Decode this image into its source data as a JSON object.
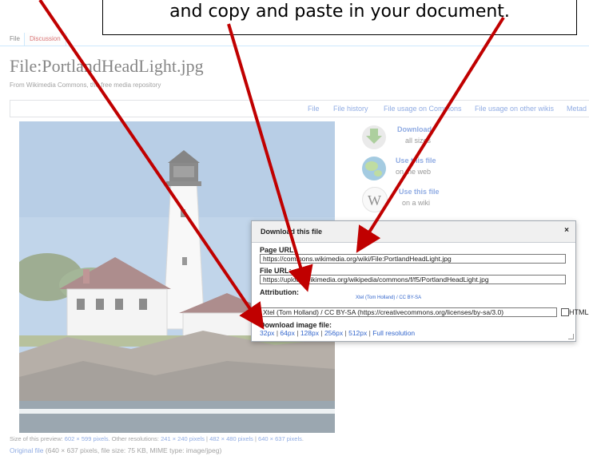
{
  "callout": {
    "text": "and copy and paste in your document."
  },
  "tabs": {
    "file": "File",
    "discussion": "Discussion"
  },
  "page": {
    "title": "File:PortlandHeadLight.jpg",
    "subtitle": "From Wikimedia Commons, the free media repository"
  },
  "file_nav": [
    "File",
    "File history",
    "File usage on Commons",
    "File usage on other wikis",
    "Metad"
  ],
  "tools": [
    {
      "title": "Download",
      "sub": "all sizes",
      "icon": "download-icon"
    },
    {
      "title": "Use this file",
      "sub": "on the web",
      "icon": "globe-icon"
    },
    {
      "title": "Use this file",
      "sub": "on a wiki",
      "icon": "wiki-icon"
    }
  ],
  "dialog": {
    "title": "Download this file",
    "close": "×",
    "page_url_label": "Page URL:",
    "page_url": "https://commons.wikimedia.org/wiki/File:PortlandHeadLight.jpg",
    "file_url_label": "File URL:",
    "file_url": "https://upload.wikimedia.org/wikipedia/commons/f/f5/PortlandHeadLight.jpg",
    "attribution_label": "Attribution:",
    "attribution_link": "Xtel (Tom Holland) / CC BY-SA",
    "attribution_text": "Xtel (Tom Holland) / CC BY-SA (https://creativecommons.org/licenses/by-sa/3.0)",
    "html_label": "HTML",
    "download_label": "Download image file:",
    "sizes": [
      "32px",
      "64px",
      "128px",
      "256px",
      "512px",
      "Full resolution"
    ]
  },
  "preview": {
    "prefix": "Size of this preview:",
    "size": "602 × 599 pixels",
    "other": ". Other resolutions:",
    "res": [
      "241 × 240 pixels",
      "482 × 480 pixels",
      "640 × 637 pixels"
    ],
    "end": "."
  },
  "original": {
    "link": "Original file",
    "detail": " (640 × 637 pixels, file size: 75 KB, MIME type: image/jpeg)"
  },
  "colors": {
    "arrow": "#c00000",
    "link": "#3366cc",
    "sky": "#8fb3d9"
  }
}
